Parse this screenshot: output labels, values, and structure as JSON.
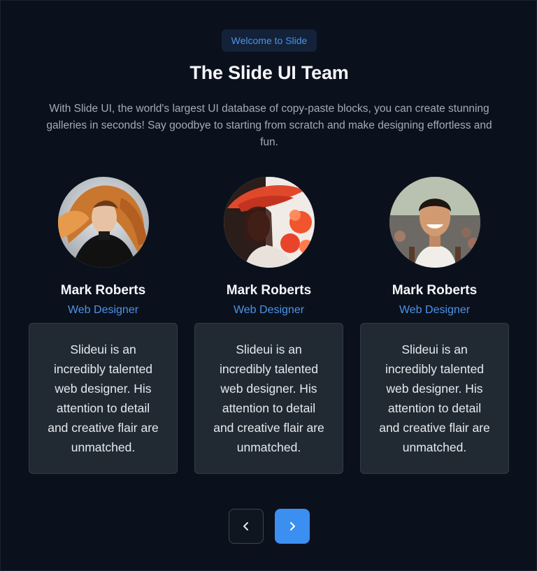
{
  "header": {
    "badge": "Welcome to Slide",
    "title": "The Slide UI Team",
    "subtitle": "With Slide UI, the world's largest UI database of copy-paste blocks, you can create stunning galleries in seconds! Say goodbye to starting from scratch and make designing effortless and fun."
  },
  "members": [
    {
      "name": "Mark Roberts",
      "role": "Web Designer",
      "bio": "Slideui is an incredibly talented web designer. His attention to detail and creative flair are unmatched.",
      "avatar": "woman-flowing-hair-portrait"
    },
    {
      "name": "Mark Roberts",
      "role": "Web Designer",
      "bio": "Slideui is an incredibly talented web designer. His attention to detail and creative flair are unmatched.",
      "avatar": "woman-red-hat-flowers-portrait"
    },
    {
      "name": "Mark Roberts",
      "role": "Web Designer",
      "bio": "Slideui is an incredibly talented web designer. His attention to detail and creative flair are unmatched.",
      "avatar": "smiling-man-street-portrait"
    }
  ],
  "navigation": {
    "prev_icon": "chevron-left-icon",
    "next_icon": "chevron-right-icon"
  },
  "colors": {
    "background": "#0b111c",
    "accent": "#3b8ff0",
    "card": "#212a33"
  }
}
